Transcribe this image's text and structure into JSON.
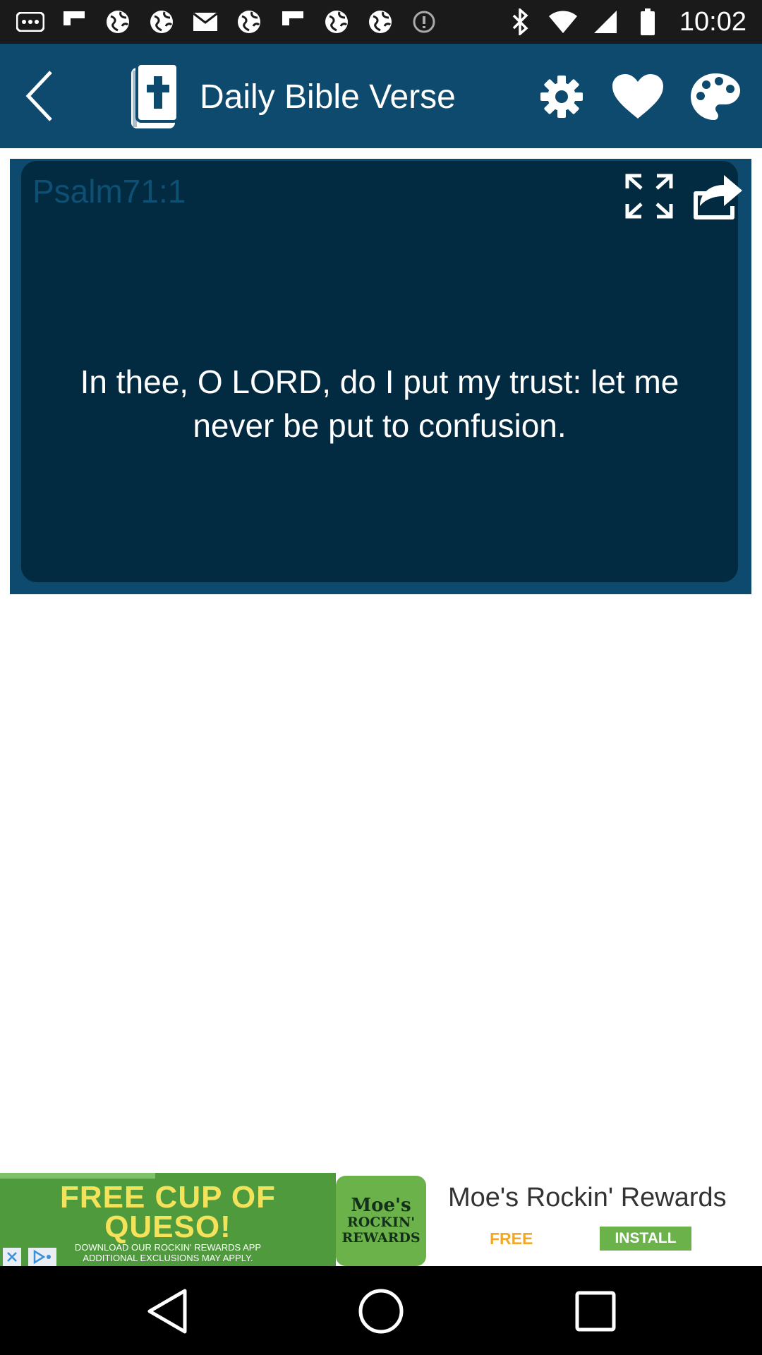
{
  "status_bar": {
    "time": "10:02",
    "notification_icons": [
      "more-icon",
      "flipboard-icon",
      "globe-icon",
      "globe-icon",
      "mail-icon",
      "globe-icon",
      "flipboard-icon",
      "globe-icon",
      "globe-icon",
      "data-saver-icon"
    ],
    "system_icons": [
      "bluetooth-icon",
      "wifi-icon",
      "signal-icon",
      "battery-icon"
    ]
  },
  "app_bar": {
    "title": "Daily Bible Verse",
    "color": "#0e4a6e",
    "back_icon": "chevron-left-icon",
    "logo_icon": "bible-icon",
    "actions": [
      "settings-icon",
      "heart-icon",
      "palette-icon"
    ]
  },
  "verse_card": {
    "reference": "Psalm71:1",
    "text": "In thee, O LORD, do I put my trust: let me never be put to confusion.",
    "background": "#022a40",
    "actions": [
      "expand-icon",
      "share-icon"
    ]
  },
  "ad": {
    "headline": "FREE CUP OF QUESO!",
    "fine_print_line1": "DOWNLOAD OUR ROCKIN' REWARDS APP",
    "fine_print_line2": "ADDITIONAL EXCLUSIONS MAY APPLY.",
    "logo_line1": "Moe's",
    "logo_line2": "ROCKIN'",
    "logo_line3": "REWARDS",
    "title": "Moe's Rockin' Rewards",
    "price": "FREE",
    "install_label": "INSTALL",
    "accent": "#6bb24a"
  },
  "nav_bar": {
    "buttons": [
      "back-triangle-icon",
      "home-circle-icon",
      "recents-square-icon"
    ]
  }
}
